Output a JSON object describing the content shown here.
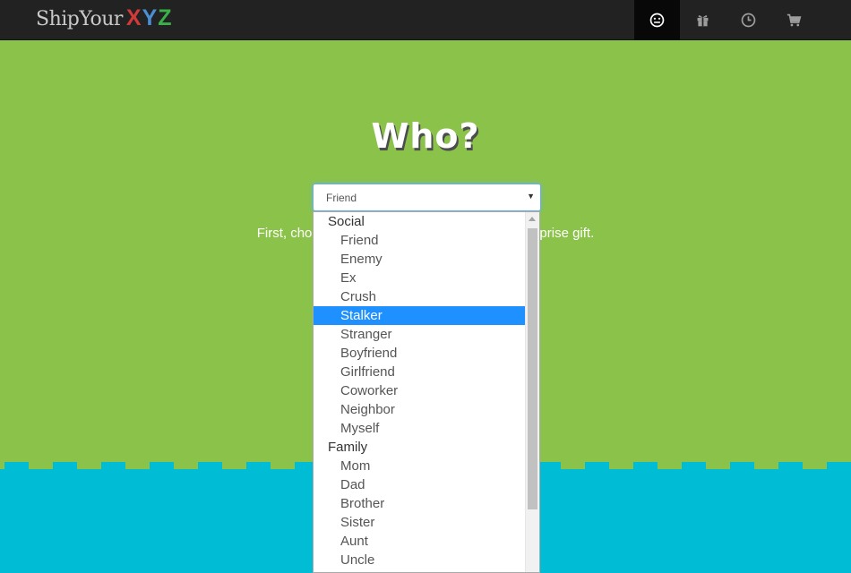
{
  "brand": {
    "part1": "ShipYour",
    "x": "X",
    "y": "Y",
    "z": "Z"
  },
  "nav": [
    {
      "name": "recipient",
      "icon": "smiley-icon",
      "active": true
    },
    {
      "name": "gift",
      "icon": "gift-icon",
      "active": false
    },
    {
      "name": "history",
      "icon": "clock-icon",
      "active": false
    },
    {
      "name": "cart",
      "icon": "cart-icon",
      "active": false
    }
  ],
  "heading": "Who?",
  "subtitle": {
    "left": "First, cho",
    "right": "prise gift."
  },
  "select": {
    "value": "Friend"
  },
  "dropdown": {
    "groups": [
      {
        "label": "Social",
        "options": [
          "Friend",
          "Enemy",
          "Ex",
          "Crush",
          "Stalker",
          "Stranger",
          "Boyfriend",
          "Girlfriend",
          "Coworker",
          "Neighbor",
          "Myself"
        ]
      },
      {
        "label": "Family",
        "options": [
          "Mom",
          "Dad",
          "Brother",
          "Sister",
          "Aunt",
          "Uncle"
        ]
      }
    ],
    "highlighted": "Stalker"
  },
  "colors": {
    "green": "#8bc34a",
    "cyan": "#00bcd4",
    "navbar": "#222222",
    "highlight": "#1e90ff"
  }
}
